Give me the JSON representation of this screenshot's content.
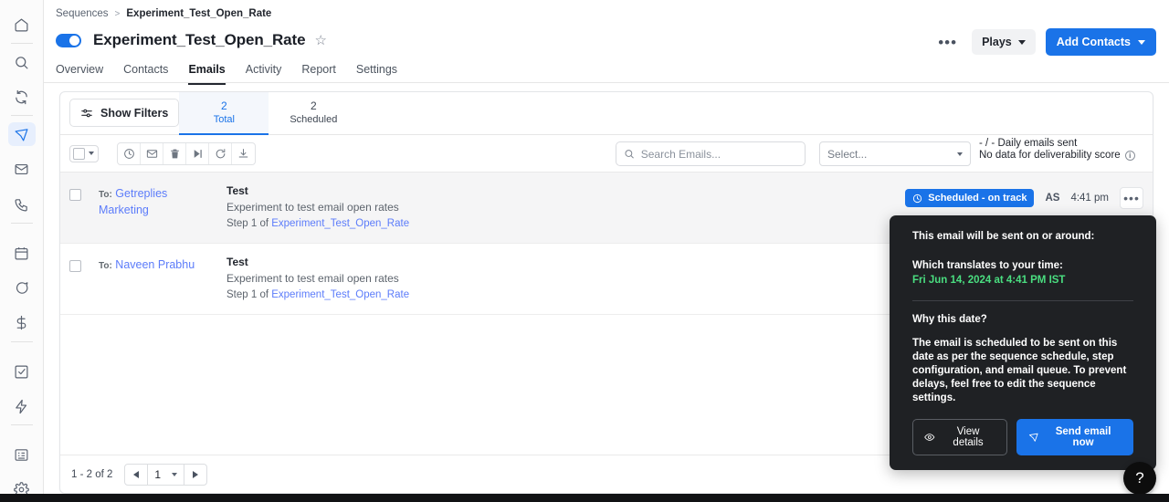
{
  "rail": {
    "items": [
      {
        "name": "home-icon",
        "label": "Home"
      },
      {
        "name": "search-icon",
        "label": "Search"
      },
      {
        "name": "sync-icon",
        "label": "Sync"
      },
      {
        "name": "send-icon",
        "label": "Sequences"
      },
      {
        "name": "mail-icon",
        "label": "Email"
      },
      {
        "name": "phone-icon",
        "label": "Calls"
      },
      {
        "name": "calendar-icon",
        "label": "Calendar"
      },
      {
        "name": "chat-icon",
        "label": "Conversations"
      },
      {
        "name": "dollar-icon",
        "label": "Deals"
      },
      {
        "name": "task-icon",
        "label": "Tasks"
      },
      {
        "name": "bolt-icon",
        "label": "Automations"
      },
      {
        "name": "list-icon",
        "label": "Reports"
      },
      {
        "name": "gear-icon",
        "label": "Settings"
      }
    ]
  },
  "breadcrumb": {
    "parent": "Sequences",
    "separator": ">",
    "current": "Experiment_Test_Open_Rate"
  },
  "header": {
    "title": "Experiment_Test_Open_Rate",
    "toggle_on": true,
    "star_glyph": "☆",
    "more_glyph": "•••",
    "plays_label": "Plays",
    "add_contacts_label": "Add Contacts"
  },
  "tabs": [
    {
      "label": "Overview",
      "active": false
    },
    {
      "label": "Contacts",
      "active": false
    },
    {
      "label": "Emails",
      "active": true
    },
    {
      "label": "Activity",
      "active": false
    },
    {
      "label": "Report",
      "active": false
    },
    {
      "label": "Settings",
      "active": false
    }
  ],
  "filterbar": {
    "show_filters_label": "Show Filters",
    "stat_tabs": [
      {
        "num": "2",
        "label": "Total",
        "active": true
      },
      {
        "num": "2",
        "label": "Scheduled",
        "active": false
      }
    ]
  },
  "actionbar": {
    "icons": [
      {
        "name": "clock-icon"
      },
      {
        "name": "envelope-icon"
      },
      {
        "name": "trash-icon"
      },
      {
        "name": "skip-next-icon"
      },
      {
        "name": "resend-icon"
      },
      {
        "name": "download-icon"
      }
    ],
    "search_placeholder": "Search Emails...",
    "select_placeholder": "Select...",
    "daily_emails_sent": "- / - Daily emails sent",
    "deliverability": "No data for deliverability score",
    "info_glyph": "i"
  },
  "rows": [
    {
      "to_label": "To:",
      "to_name": "Getreplies Marketing",
      "subject": "Test",
      "preview": "Experiment to test email open rates",
      "step_prefix": "Step 1 of ",
      "step_link": "Experiment_Test_Open_Rate",
      "status": "Scheduled - on track",
      "avatar": "AS",
      "time": "4:41 pm",
      "dots": "•••",
      "hovered": true
    },
    {
      "to_label": "To:",
      "to_name": "Naveen Prabhu",
      "subject": "Test",
      "preview": "Experiment to test email open rates",
      "step_prefix": "Step 1 of ",
      "step_link": "Experiment_Test_Open_Rate",
      "status": "",
      "avatar": "",
      "time": "",
      "dots": "•••",
      "hovered": false
    }
  ],
  "footer": {
    "range": "1 - 2 of 2",
    "page": "1"
  },
  "tooltip": {
    "line1": "This email will be sent on or around:",
    "line2": "Which translates to your time:",
    "local_time": "Fri Jun 14, 2024 at 4:41 PM IST",
    "why_heading": "Why this date?",
    "why_body": "The email is scheduled to be sent on this date as per the sequence schedule, step configuration, and email queue. To prevent delays, feel free to edit the sequence settings.",
    "view_details_label": "View details",
    "send_now_label": "Send email now"
  },
  "help": {
    "glyph": "?"
  },
  "colors": {
    "accent_blue": "#1a73e8",
    "link_blue": "#5c7cfa",
    "tooltip_bg": "#1f2124",
    "tooltip_green": "#4ade80"
  }
}
